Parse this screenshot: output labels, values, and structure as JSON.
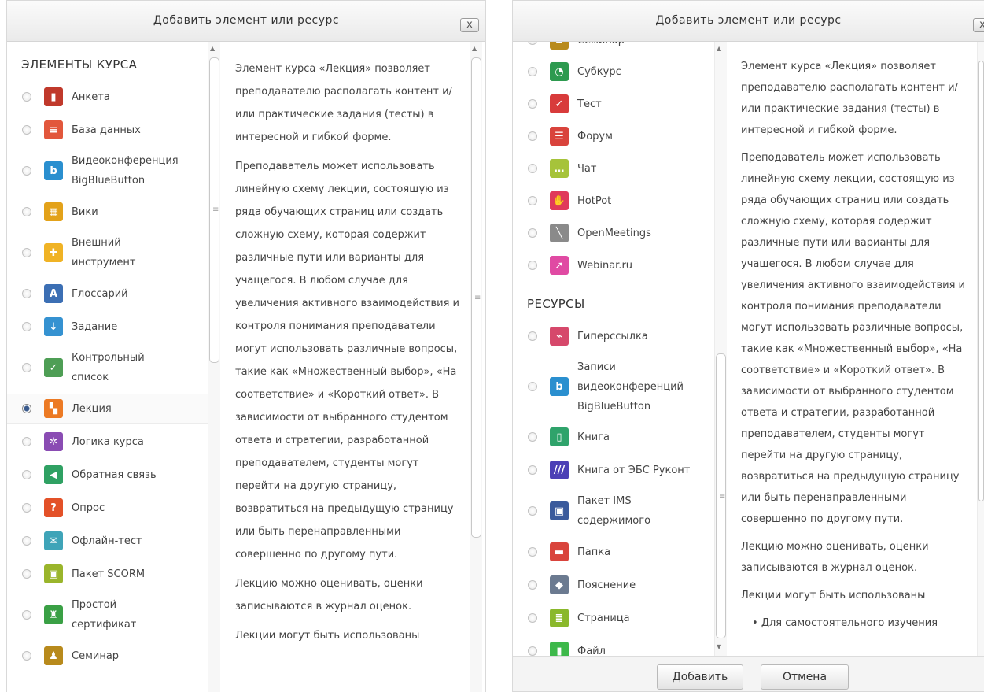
{
  "left": {
    "title": "Добавить элемент или ресурс",
    "close": "x",
    "section": "ЭЛЕМЕНТЫ КУРСА",
    "items": [
      {
        "label": "Анкета",
        "icon": "chart-icon",
        "color": "#c0392b",
        "glyph": "▮",
        "selected": false
      },
      {
        "label": "База данных",
        "icon": "database-icon",
        "color": "#e2573c",
        "glyph": "≡",
        "selected": false
      },
      {
        "label": "Видеоконференция\nBigBlueButton",
        "icon": "bigbluebutton-icon",
        "color": "#2a8fcf",
        "glyph": "b",
        "selected": false
      },
      {
        "label": "Вики",
        "icon": "wiki-icon",
        "color": "#e3a21a",
        "glyph": "▦",
        "selected": false
      },
      {
        "label": "Внешний\nинструмент",
        "icon": "puzzle-icon",
        "color": "#f0b325",
        "glyph": "✚",
        "selected": false
      },
      {
        "label": "Глоссарий",
        "icon": "glossary-icon",
        "color": "#3c6fb4",
        "glyph": "A",
        "selected": false
      },
      {
        "label": "Задание",
        "icon": "assignment-icon",
        "color": "#3592d1",
        "glyph": "↓",
        "selected": false
      },
      {
        "label": "Контрольный\nсписок",
        "icon": "checklist-icon",
        "color": "#4e9e55",
        "glyph": "✓",
        "selected": false
      },
      {
        "label": "Лекция",
        "icon": "lesson-icon",
        "color": "#ec7a24",
        "glyph": "▚",
        "selected": true
      },
      {
        "label": "Логика курса",
        "icon": "gear-icon",
        "color": "#8a4cb3",
        "glyph": "✲",
        "selected": false
      },
      {
        "label": "Обратная связь",
        "icon": "megaphone-icon",
        "color": "#2fa163",
        "glyph": "◀",
        "selected": false
      },
      {
        "label": "Опрос",
        "icon": "question-icon",
        "color": "#e35128",
        "glyph": "?",
        "selected": false
      },
      {
        "label": "Офлайн-тест",
        "icon": "envelope-icon",
        "color": "#3fa4b8",
        "glyph": "✉",
        "selected": false
      },
      {
        "label": "Пакет SCORM",
        "icon": "scorm-icon",
        "color": "#9ab52b",
        "glyph": "▣",
        "selected": false
      },
      {
        "label": "Простой\nсертификат",
        "icon": "certificate-icon",
        "color": "#3aa045",
        "glyph": "♜",
        "selected": false
      },
      {
        "label": "Семинар",
        "icon": "workshop-icon",
        "color": "#b88a1c",
        "glyph": "♟",
        "selected": false
      }
    ],
    "description": [
      "Элемент курса «Лекция» позволяет преподавателю располагать контент и/или практические задания (тесты) в интересной и гибкой форме.",
      "Преподаватель может использовать линейную схему лекции, состоящую из ряда обучающих страниц или создать сложную схему, которая содержит различные пути или варианты для учащегося. В любом случае для увеличения активного взаимодействия и контроля понимания преподаватели могут использовать различные вопросы, такие как «Множественный выбор», «На соответствие» и «Короткий ответ». В зависимости от выбранного студентом ответа и стратегии, разработанной преподавателем, студенты могут перейти на другую страницу, возвратиться на предыдущую страницу или быть перенаправленными совершенно по другому пути.",
      "Лекцию можно оценивать, оценки записываются в журнал оценок.",
      "Лекции могут быть использованы"
    ]
  },
  "right": {
    "title": "Добавить элемент или ресурс",
    "close": "x",
    "partial_label": "Семинар",
    "items_top": [
      {
        "label": "Субкурс",
        "icon": "subcourse-icon",
        "color": "#2d9a4f",
        "glyph": "◔"
      },
      {
        "label": "Тест",
        "icon": "quiz-icon",
        "color": "#d83b3b",
        "glyph": "✓"
      },
      {
        "label": "Форум",
        "icon": "forum-icon",
        "color": "#d9433c",
        "glyph": "☰"
      },
      {
        "label": "Чат",
        "icon": "chat-icon",
        "color": "#a6c33a",
        "glyph": "…"
      },
      {
        "label": "HotPot",
        "icon": "hotpot-icon",
        "color": "#e0395a",
        "glyph": "✋"
      },
      {
        "label": "OpenMeetings",
        "icon": "openmeetings-icon",
        "color": "#8a8a8a",
        "glyph": "╲"
      },
      {
        "label": "Webinar.ru",
        "icon": "webinar-icon",
        "color": "#e04aa3",
        "glyph": "➚"
      }
    ],
    "section": "РЕСУРСЫ",
    "items_resources": [
      {
        "label": "Гиперссылка",
        "icon": "link-icon",
        "color": "#d6486b",
        "glyph": "⌁"
      },
      {
        "label": "Записи\nвидеоконференций\nBigBlueButton",
        "icon": "recordings-icon",
        "color": "#2a8fcf",
        "glyph": "b"
      },
      {
        "label": "Книга",
        "icon": "book-icon",
        "color": "#2fa36b",
        "glyph": "▯"
      },
      {
        "label": "Книга от ЭБС Руконт",
        "icon": "rucont-icon",
        "color": "#4b3fb6",
        "glyph": "///"
      },
      {
        "label": "Пакет IMS\nсодержимого",
        "icon": "ims-icon",
        "color": "#3a5a9c",
        "glyph": "▣"
      },
      {
        "label": "Папка",
        "icon": "folder-icon",
        "color": "#d9443c",
        "glyph": "▬"
      },
      {
        "label": "Пояснение",
        "icon": "tag-icon",
        "color": "#6b7a90",
        "glyph": "◆"
      },
      {
        "label": "Страница",
        "icon": "page-icon",
        "color": "#8ab82b",
        "glyph": "≣"
      },
      {
        "label": "Файл",
        "icon": "file-icon",
        "color": "#3db84a",
        "glyph": "▮"
      }
    ],
    "description": [
      "Элемент курса «Лекция» позволяет преподавателю располагать контент и/или практические задания (тесты) в интересной и гибкой форме.",
      "Преподаватель может использовать линейную схему лекции, состоящую из ряда обучающих страниц или создать сложную схему, которая содержит различные пути или варианты для учащегося. В любом случае для увеличения активного взаимодействия и контроля понимания преподаватели могут использовать различные вопросы, такие как «Множественный выбор», «На соответствие» и «Короткий ответ». В зависимости от выбранного студентом ответа и стратегии, разработанной преподавателем, студенты могут перейти на другую страницу, возвратиться на предыдущую страницу или быть перенаправленными совершенно по другому пути.",
      "Лекцию можно оценивать, оценки записываются в журнал оценок.",
      "Лекции могут быть использованы"
    ],
    "bullet": "Для самостоятельного изучения",
    "add_button": "Добавить",
    "cancel_button": "Отмена"
  }
}
